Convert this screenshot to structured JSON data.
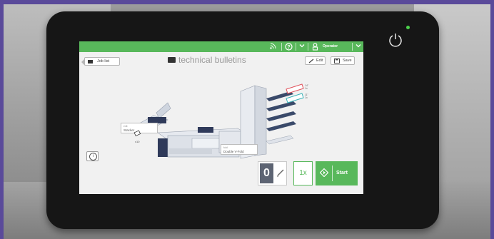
{
  "topbar": {
    "color": "#58b85b",
    "icons": [
      "rss-icon",
      "help-icon",
      "chevron-down-icon",
      "user-icon",
      "chevron-down-icon"
    ],
    "operator_label": "Operator"
  },
  "toolbar": {
    "job_list_label": "Job list",
    "job_title": "technical bulletins",
    "edit_label": "Edit",
    "save_label": "Save"
  },
  "diagram": {
    "stacker_label": "Stacker",
    "stacker_sub": "exit",
    "fold_label": "Double V-Fold",
    "fold_sub": "fold",
    "stack_count": "x10",
    "feeder_labels": [
      {
        "l1": "14\"",
        "l2": "1x"
      },
      {
        "l1": "11\"",
        "l2": "1x"
      }
    ]
  },
  "controls": {
    "counter_value": "0",
    "multiplier": "1x",
    "start_label": "Start"
  }
}
